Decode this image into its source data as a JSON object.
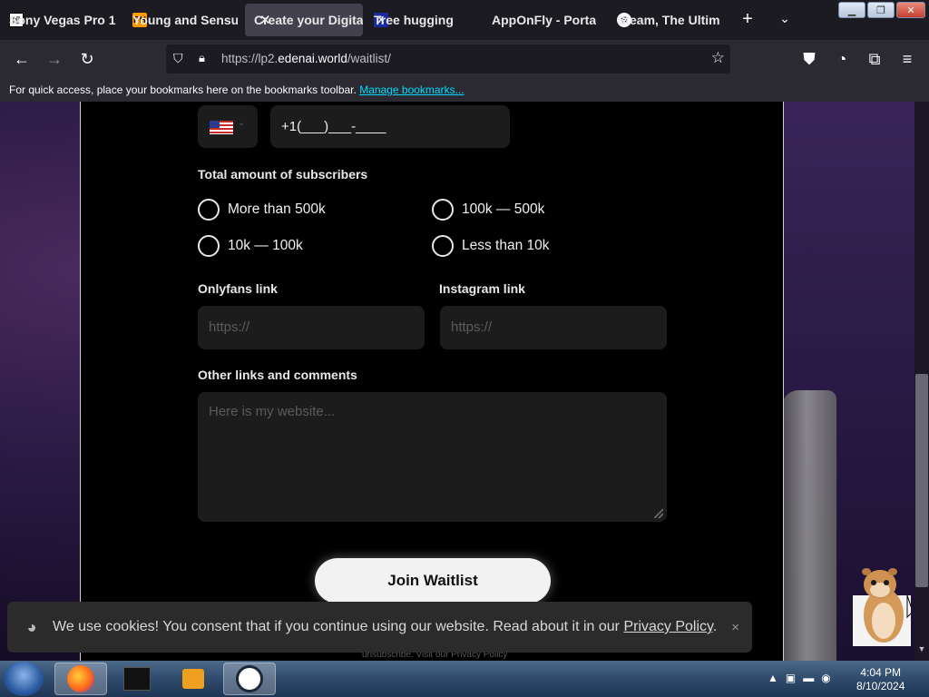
{
  "browser": {
    "tabs": [
      {
        "title": "Sony Vegas Pro 1",
        "icon": "sony-icon",
        "active": false
      },
      {
        "title": "Young and Sensu",
        "icon": "ph-icon",
        "fav_text": "PH",
        "active": false
      },
      {
        "title": "Create your Digital",
        "icon": "page-icon",
        "active": true
      },
      {
        "title": "Tree hugging",
        "icon": "x-icon",
        "fav_text": "X",
        "active": false
      },
      {
        "title": "AppOnFly - Porta",
        "icon": "app-icon",
        "active": false
      },
      {
        "title": "Steam, The Ultim",
        "icon": "steam-icon",
        "active": false
      }
    ],
    "url_prefix": "https://lp2.",
    "url_domain": "edenai.world",
    "url_path": "/waitlist/",
    "bookmarks_message": "For quick access, place your bookmarks here on the bookmarks toolbar.",
    "bookmarks_link": "Manage bookmarks..."
  },
  "form": {
    "phone_value": "+1(___)___-____",
    "subscribers_label": "Total amount of subscribers",
    "subscriber_options": [
      "More than 500k",
      "100k — 500k",
      "10k — 100k",
      "Less than 10k"
    ],
    "onlyfans_label": "Onlyfans link",
    "onlyfans_placeholder": "https://",
    "instagram_label": "Instagram link",
    "instagram_placeholder": "https://",
    "other_label": "Other links and comments",
    "other_placeholder": "Here is my website...",
    "submit_label": "Join Waitlist",
    "footer_text": "unsubscribe. Visit our Privacy Policy"
  },
  "cookie": {
    "message": "We use cookies! You consent that if you continue using our website. Read about it in our ",
    "link": "Privacy Policy",
    "suffix": ".",
    "close": "×"
  },
  "taskbar": {
    "time": "4:04 PM",
    "date": "8/10/2024"
  },
  "colors": {
    "browser_chrome": "#1c1b22",
    "navbar": "#2b2a33",
    "panel": "#000000",
    "field": "#1c1c1c",
    "link": "#00ddff"
  }
}
